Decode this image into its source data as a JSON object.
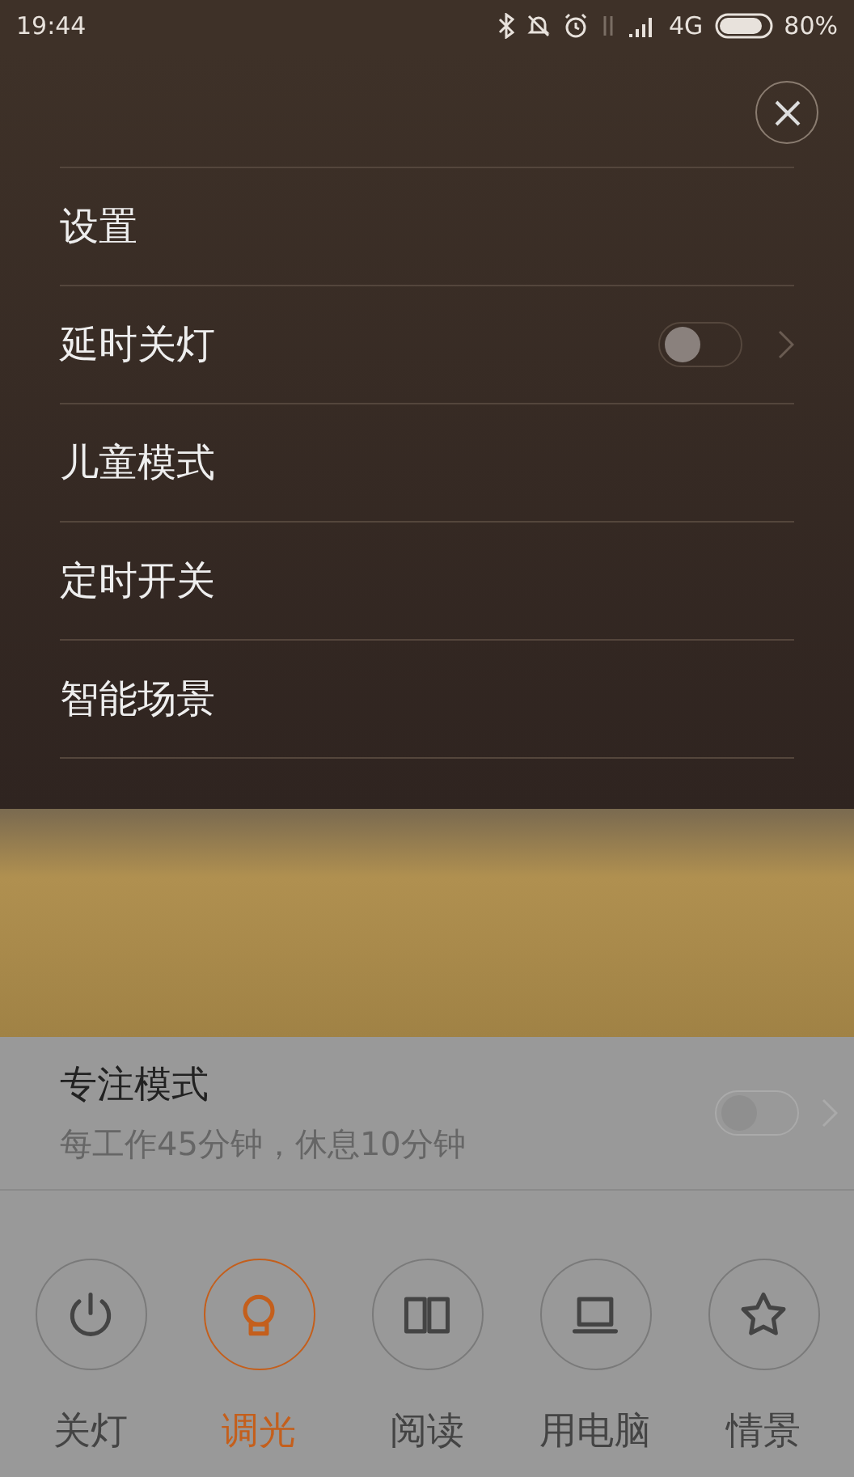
{
  "status_bar": {
    "time": "19:44",
    "network": "4G",
    "battery": "80%"
  },
  "menu": {
    "items": [
      {
        "label": "设置",
        "kind": "plain"
      },
      {
        "label": "延时关灯",
        "kind": "toggle",
        "on": false
      },
      {
        "label": "儿童模式",
        "kind": "plain"
      },
      {
        "label": "定时开关",
        "kind": "plain"
      },
      {
        "label": "智能场景",
        "kind": "plain"
      }
    ]
  },
  "focus_mode": {
    "title": "专注模式",
    "subtitle": "每工作45分钟，休息10分钟",
    "on": false
  },
  "modes": [
    {
      "label": "关灯",
      "kind": "power",
      "selected": false
    },
    {
      "label": "调光",
      "kind": "bulb",
      "selected": true
    },
    {
      "label": "阅读",
      "kind": "book",
      "selected": false
    },
    {
      "label": "用电脑",
      "kind": "laptop",
      "selected": false
    },
    {
      "label": "情景",
      "kind": "star",
      "selected": false
    }
  ]
}
